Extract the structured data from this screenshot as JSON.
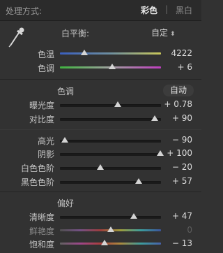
{
  "header": {
    "treatment_label": "处理方式:",
    "color_option": "彩色",
    "separator": "|",
    "bw_option": "黑白"
  },
  "white_balance": {
    "label": "白平衡:",
    "value": "自定",
    "eyedropper_icon": "eyedropper-icon",
    "sliders": [
      {
        "label": "色温",
        "value": "4222",
        "position": 0.24
      },
      {
        "label": "色调",
        "value": "+ 6",
        "position": 0.52
      }
    ]
  },
  "tone": {
    "title": "色调",
    "auto_label": "自动",
    "sliders": [
      {
        "label": "曝光度",
        "value": "+ 0.78",
        "position": 0.57
      },
      {
        "label": "对比度",
        "value": "+ 90",
        "position": 0.94
      },
      {
        "label": "高光",
        "value": "− 90",
        "position": 0.05
      },
      {
        "label": "阴影",
        "value": "+ 100",
        "position": 0.99
      },
      {
        "label": "白色色阶",
        "value": "− 20",
        "position": 0.4
      },
      {
        "label": "黑色色阶",
        "value": "+ 57",
        "position": 0.78
      }
    ]
  },
  "presence": {
    "title": "偏好",
    "sliders": [
      {
        "label": "清晰度",
        "value": "+ 47",
        "position": 0.73
      },
      {
        "label": "鲜艳度",
        "value": "0",
        "position": 0.5
      },
      {
        "label": "饱和度",
        "value": "− 13",
        "position": 0.44
      }
    ]
  },
  "colors": {
    "background": "#323232",
    "thumb": "#d4d4d4"
  }
}
